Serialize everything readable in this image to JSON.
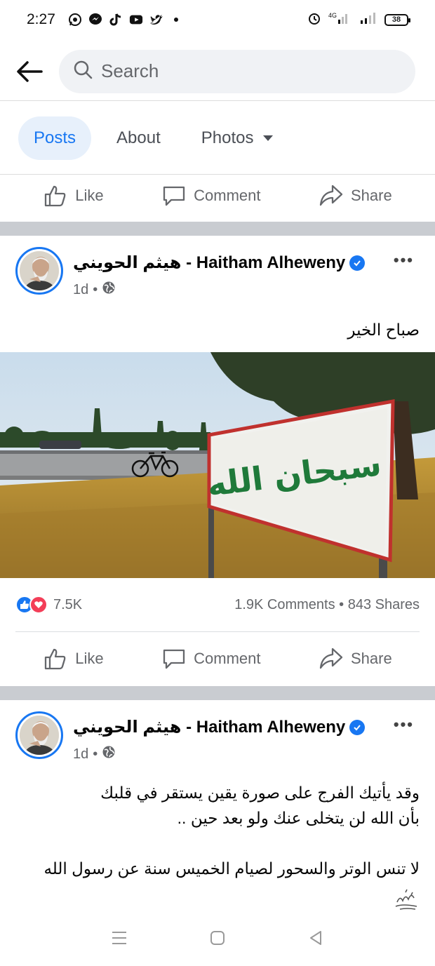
{
  "status_bar": {
    "time": "2:27",
    "battery": "38",
    "network": "4G"
  },
  "search": {
    "placeholder": "Search"
  },
  "tabs": [
    {
      "label": "Posts",
      "active": true
    },
    {
      "label": "About",
      "active": false
    },
    {
      "label": "Photos",
      "active": false,
      "has_dropdown": true
    }
  ],
  "actions": {
    "like": "Like",
    "comment": "Comment",
    "share": "Share"
  },
  "posts": [
    {
      "author": "هيثم الحويني - Haitham Alheweny",
      "time": "1d",
      "text": "صباح الخير",
      "photo_sign_text": "سبحان الله",
      "reaction_count": "7.5K",
      "stats": "1.9K Comments • 843 Shares"
    },
    {
      "author": "هيثم الحويني - Haitham Alheweny",
      "time": "1d",
      "text_lines": [
        "وقد يأتيك الفرج على صورة يقين يستقر في قلبك",
        "بأن الله لن يتخلى عنك ولو بعد حين ..",
        "",
        "لا تنس الوتر والسحور لصيام الخميس سنة عن رسول الله"
      ]
    }
  ],
  "colors": {
    "accent": "#1877f2",
    "love": "#f33e58",
    "separator": "#c9ccd1",
    "sign_green": "#1f7a3a"
  }
}
